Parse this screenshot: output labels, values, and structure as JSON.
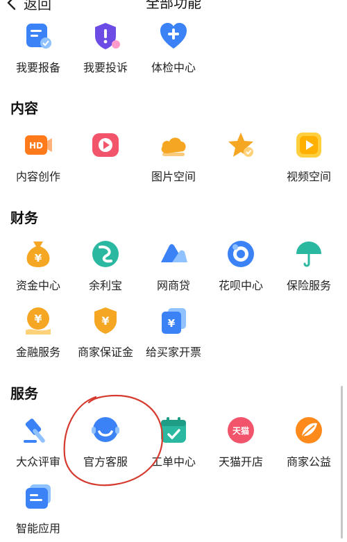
{
  "header": {
    "back_label": "返回",
    "title": "全部功能"
  },
  "sections": {
    "top": {
      "items": [
        "我要报备",
        "我要投诉",
        "体检中心"
      ]
    },
    "content": {
      "title": "内容",
      "items": [
        "内容创作",
        "",
        "图片空间",
        "",
        "视频空间"
      ]
    },
    "finance": {
      "title": "财务",
      "items": [
        "资金中心",
        "余利宝",
        "网商贷",
        "花呗中心",
        "保险服务",
        "金融服务",
        "商家保证金",
        "给买家开票"
      ]
    },
    "service": {
      "title": "服务",
      "items": [
        "大众评审",
        "官方客服",
        "工单中心",
        "天猫开店",
        "商家公益",
        "智能应用"
      ]
    }
  },
  "icon_badges": {
    "tmall": "天猫",
    "hd": "HD",
    "yuan": "¥"
  },
  "colors": {
    "blue": "#3b82f6",
    "orange": "#f5a623",
    "red": "#f2556b",
    "green": "#2bb8a0",
    "annotation": "#d63a2f"
  }
}
